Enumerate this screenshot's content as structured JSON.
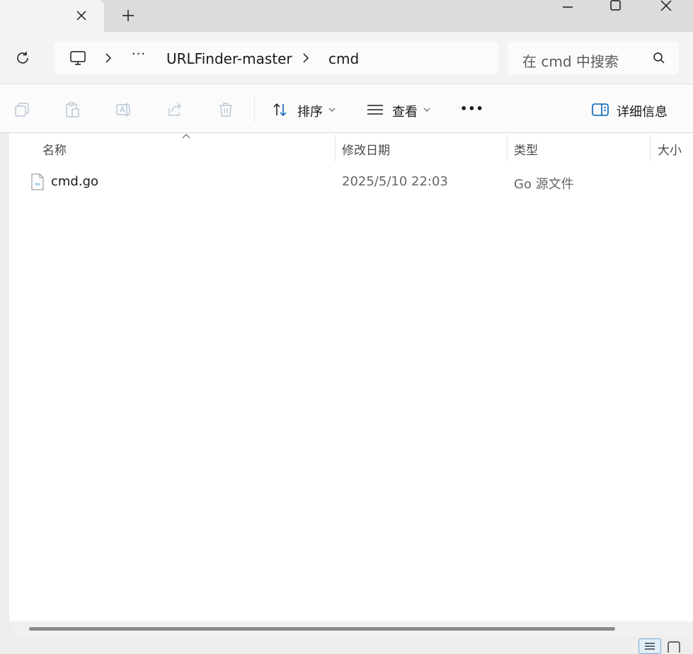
{
  "tab": {
    "close_icon": "close-icon",
    "new_tab_icon": "plus-icon"
  },
  "window": {
    "minimize_icon": "minimize-icon",
    "maximize_icon": "maximize-icon",
    "close_icon": "close-icon"
  },
  "address": {
    "refresh_icon": "refresh-icon",
    "computer_icon": "computer-icon",
    "ellipsis": "···",
    "crumbs": [
      "URLFinder-master",
      "cmd"
    ]
  },
  "search": {
    "placeholder": "在 cmd 中搜索"
  },
  "toolbar": {
    "sort_label": "排序",
    "view_label": "查看",
    "more_label": "•••",
    "details_label": "详细信息"
  },
  "columns": {
    "name": "名称",
    "modified": "修改日期",
    "type": "类型",
    "size": "大小"
  },
  "files": [
    {
      "name": "cmd.go",
      "modified": "2025/5/10 22:03",
      "type": "Go 源文件",
      "size": ""
    }
  ],
  "colors": {
    "accent": "#005fb8",
    "scrollbar": "#8a8a8a"
  }
}
